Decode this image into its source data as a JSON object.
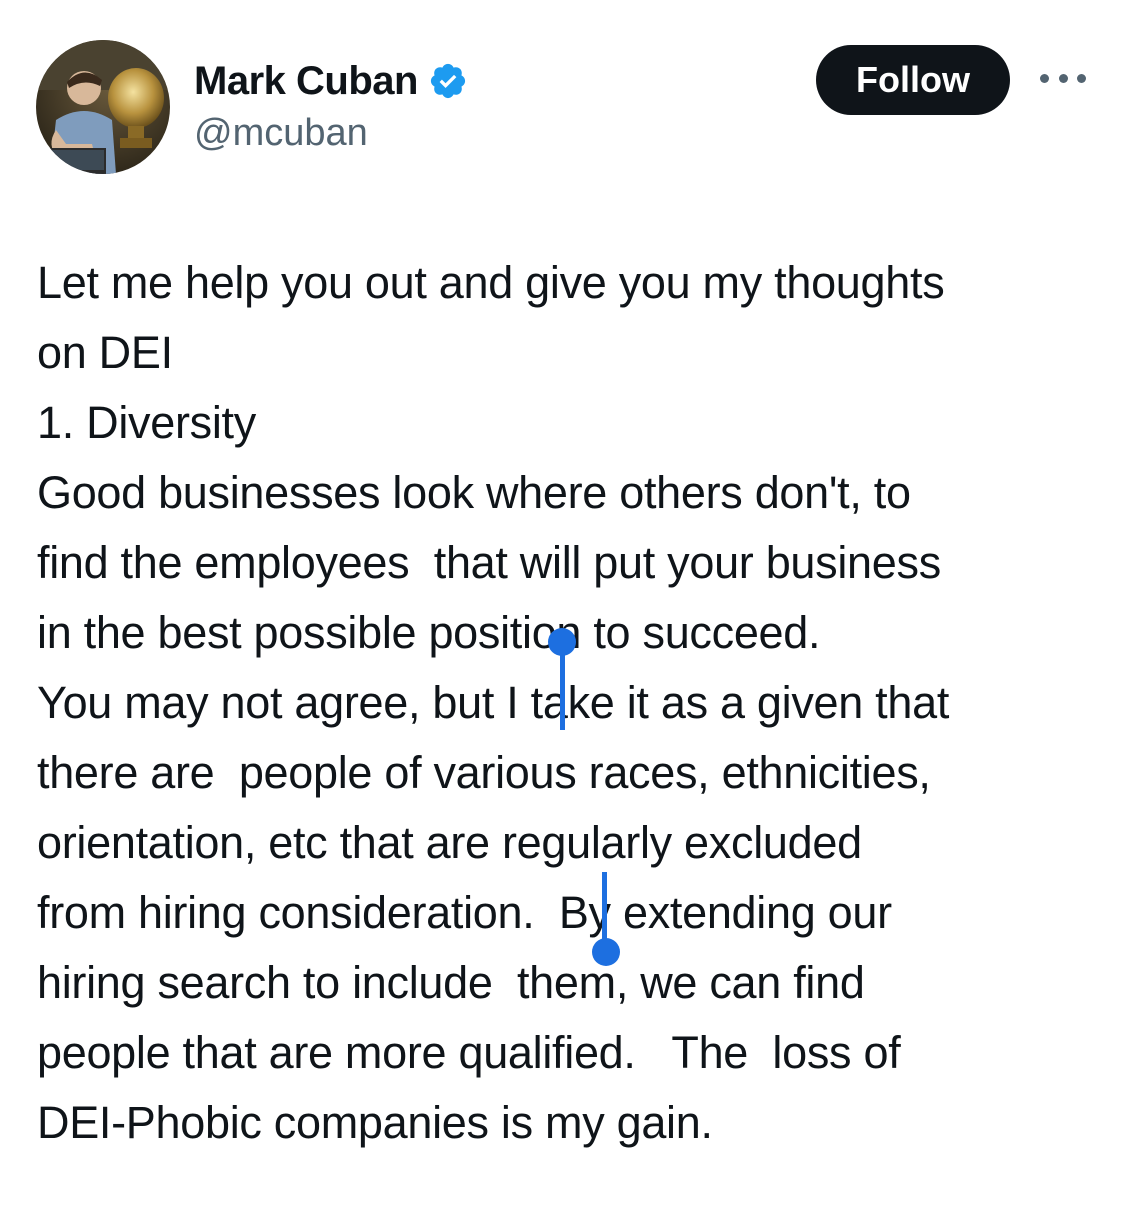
{
  "author": {
    "display_name": "Mark Cuban",
    "handle": "@mcuban",
    "verified": true,
    "avatar_icon": "profile-photo"
  },
  "actions": {
    "follow_label": "Follow",
    "more_icon": "ellipsis-icon"
  },
  "tweet": {
    "lines": [
      "Let me help you out and give you my thoughts",
      "on DEI",
      "1. Diversity",
      "Good businesses look where others don't, to",
      "find the employees  that will put your business",
      "in the best possible position to succeed.",
      "You may not agree, but I take it as a given that",
      "there are  people of various races, ethnicities,",
      "orientation, etc that are regularly excluded",
      "from hiring consideration.  By extending our",
      "hiring search to include  them, we can find",
      "people that are more qualified.   The  loss of",
      "DEI-Phobic companies is my gain."
    ],
    "selected_text": "I take it as a given that there are  people of various races, ethnicities, orientation, etc that are regularly excluded from hiring consideration"
  },
  "colors": {
    "verified_badge": "#1d9bf0",
    "selection_highlight": "#c9daec",
    "selection_handle": "#1d6fe0",
    "follow_button": "#0f1419"
  }
}
